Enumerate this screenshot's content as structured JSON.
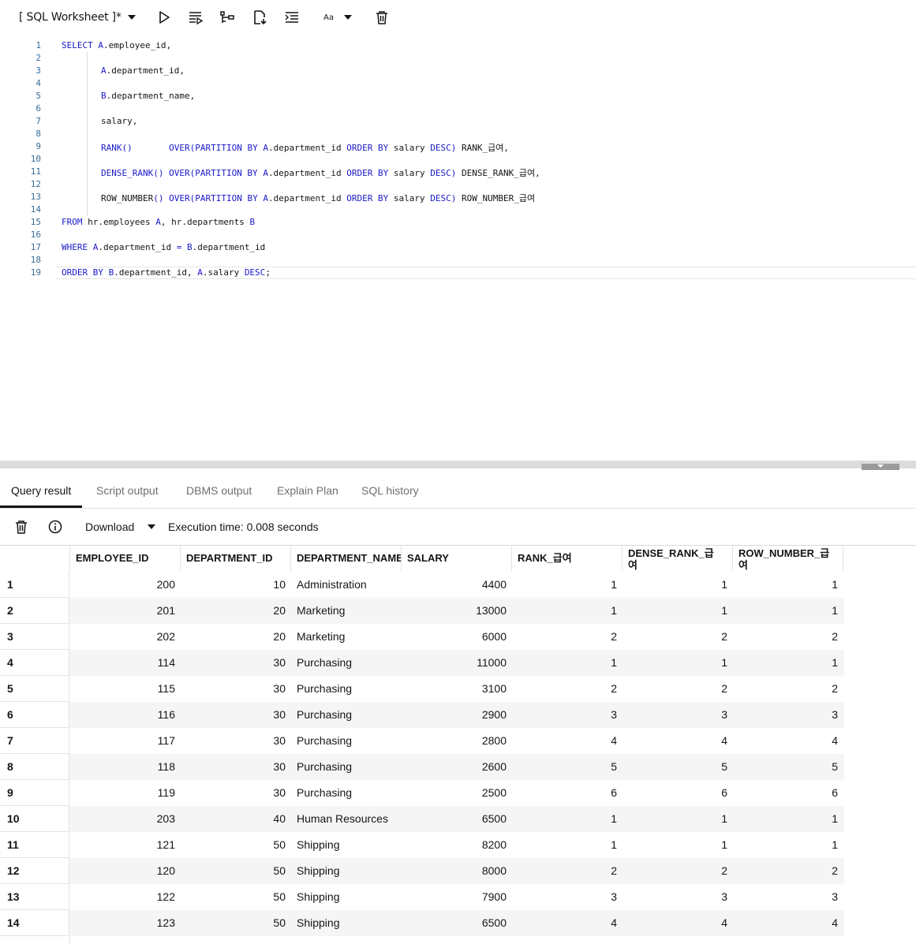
{
  "toolbar": {
    "title": "[ SQL Worksheet ]*",
    "font_label": "Aa",
    "icons": [
      "chevron-down-icon",
      "run-icon",
      "run-script-icon",
      "explain-plan-icon",
      "autotrace-icon",
      "format-icon",
      "font-size-icon",
      "clear-icon"
    ]
  },
  "editor": {
    "line_numbers": [
      "1",
      "2",
      "3",
      "4",
      "5",
      "6",
      "7",
      "8",
      "9",
      "10",
      "11",
      "12",
      "13",
      "14",
      "15",
      "16",
      "17",
      "18",
      "19"
    ],
    "lines": [
      {
        "n": 1,
        "segments": [
          [
            "kw",
            "SELECT "
          ],
          [
            "kw",
            "A"
          ],
          [
            "t",
            ".employee_id,"
          ]
        ]
      },
      {
        "n": 3,
        "segments": [
          [
            "kw",
            "A"
          ],
          [
            "t",
            ".department_id,"
          ]
        ]
      },
      {
        "n": 5,
        "segments": [
          [
            "kw",
            "B"
          ],
          [
            "t",
            ".department_name,"
          ]
        ]
      },
      {
        "n": 7,
        "segments": [
          [
            "t",
            "salary,"
          ]
        ]
      },
      {
        "n": 9,
        "segments": [
          [
            "kw",
            "RANK()"
          ],
          [
            "t",
            "       "
          ],
          [
            "kw",
            "OVER(PARTITION BY "
          ],
          [
            "kw",
            "A"
          ],
          [
            "t",
            ".department_id "
          ],
          [
            "kw",
            "ORDER BY "
          ],
          [
            "t",
            "salary "
          ],
          [
            "kw",
            "DESC) "
          ],
          [
            "t",
            "RANK_급여,"
          ]
        ]
      },
      {
        "n": 11,
        "segments": [
          [
            "kw",
            "DENSE_RANK() "
          ],
          [
            "kw",
            "OVER(PARTITION BY "
          ],
          [
            "kw",
            "A"
          ],
          [
            "t",
            ".department_id "
          ],
          [
            "kw",
            "ORDER BY "
          ],
          [
            "t",
            "salary "
          ],
          [
            "kw",
            "DESC) "
          ],
          [
            "t",
            "DENSE_RANK_급여,"
          ]
        ]
      },
      {
        "n": 13,
        "segments": [
          [
            "t",
            "ROW_NUMBER"
          ],
          [
            "kw",
            "() "
          ],
          [
            "kw",
            "OVER(PARTITION BY "
          ],
          [
            "kw",
            "A"
          ],
          [
            "t",
            ".department_id "
          ],
          [
            "kw",
            "ORDER BY "
          ],
          [
            "t",
            "salary "
          ],
          [
            "kw",
            "DESC) "
          ],
          [
            "t",
            "ROW_NUMBER_급여"
          ]
        ]
      },
      {
        "n": 15,
        "segments": [
          [
            "kw",
            "FROM "
          ],
          [
            "t",
            "hr.employees "
          ],
          [
            "kw",
            "A"
          ],
          [
            "t",
            ", "
          ],
          [
            "t",
            "hr.departments "
          ],
          [
            "kw",
            "B"
          ]
        ]
      },
      {
        "n": 17,
        "segments": [
          [
            "kw",
            "WHERE "
          ],
          [
            "kw",
            "A"
          ],
          [
            "t",
            ".department_id "
          ],
          [
            "kw",
            "= "
          ],
          [
            "kw",
            "B"
          ],
          [
            "t",
            ".department_id"
          ]
        ]
      },
      {
        "n": 19,
        "segments": [
          [
            "kw",
            "ORDER BY "
          ],
          [
            "kw",
            "B"
          ],
          [
            "t",
            ".department_id, "
          ],
          [
            "kw",
            "A"
          ],
          [
            "t",
            ".salary "
          ],
          [
            "kw",
            "DESC"
          ],
          [
            "t",
            ";"
          ]
        ]
      }
    ]
  },
  "tabs": [
    "Query result",
    "Script output",
    "DBMS output",
    "Explain Plan",
    "SQL history"
  ],
  "results_bar": {
    "download_label": "Download",
    "exec_time": "Execution time: 0.008 seconds"
  },
  "grid": {
    "columns": [
      "EMPLOYEE_ID",
      "DEPARTMENT_ID",
      "DEPARTMENT_NAME",
      "SALARY",
      "RANK_급여",
      "DENSE_RANK_급여",
      "ROW_NUMBER_급여"
    ],
    "rows": [
      [
        "1",
        "200",
        "10",
        "Administration",
        "4400",
        "1",
        "1",
        "1"
      ],
      [
        "2",
        "201",
        "20",
        "Marketing",
        "13000",
        "1",
        "1",
        "1"
      ],
      [
        "3",
        "202",
        "20",
        "Marketing",
        "6000",
        "2",
        "2",
        "2"
      ],
      [
        "4",
        "114",
        "30",
        "Purchasing",
        "11000",
        "1",
        "1",
        "1"
      ],
      [
        "5",
        "115",
        "30",
        "Purchasing",
        "3100",
        "2",
        "2",
        "2"
      ],
      [
        "6",
        "116",
        "30",
        "Purchasing",
        "2900",
        "3",
        "3",
        "3"
      ],
      [
        "7",
        "117",
        "30",
        "Purchasing",
        "2800",
        "4",
        "4",
        "4"
      ],
      [
        "8",
        "118",
        "30",
        "Purchasing",
        "2600",
        "5",
        "5",
        "5"
      ],
      [
        "9",
        "119",
        "30",
        "Purchasing",
        "2500",
        "6",
        "6",
        "6"
      ],
      [
        "10",
        "203",
        "40",
        "Human Resources",
        "6500",
        "1",
        "1",
        "1"
      ],
      [
        "11",
        "121",
        "50",
        "Shipping",
        "8200",
        "1",
        "1",
        "1"
      ],
      [
        "12",
        "120",
        "50",
        "Shipping",
        "8000",
        "2",
        "2",
        "2"
      ],
      [
        "13",
        "122",
        "50",
        "Shipping",
        "7900",
        "3",
        "3",
        "3"
      ],
      [
        "14",
        "123",
        "50",
        "Shipping",
        "6500",
        "4",
        "4",
        "4"
      ]
    ]
  }
}
